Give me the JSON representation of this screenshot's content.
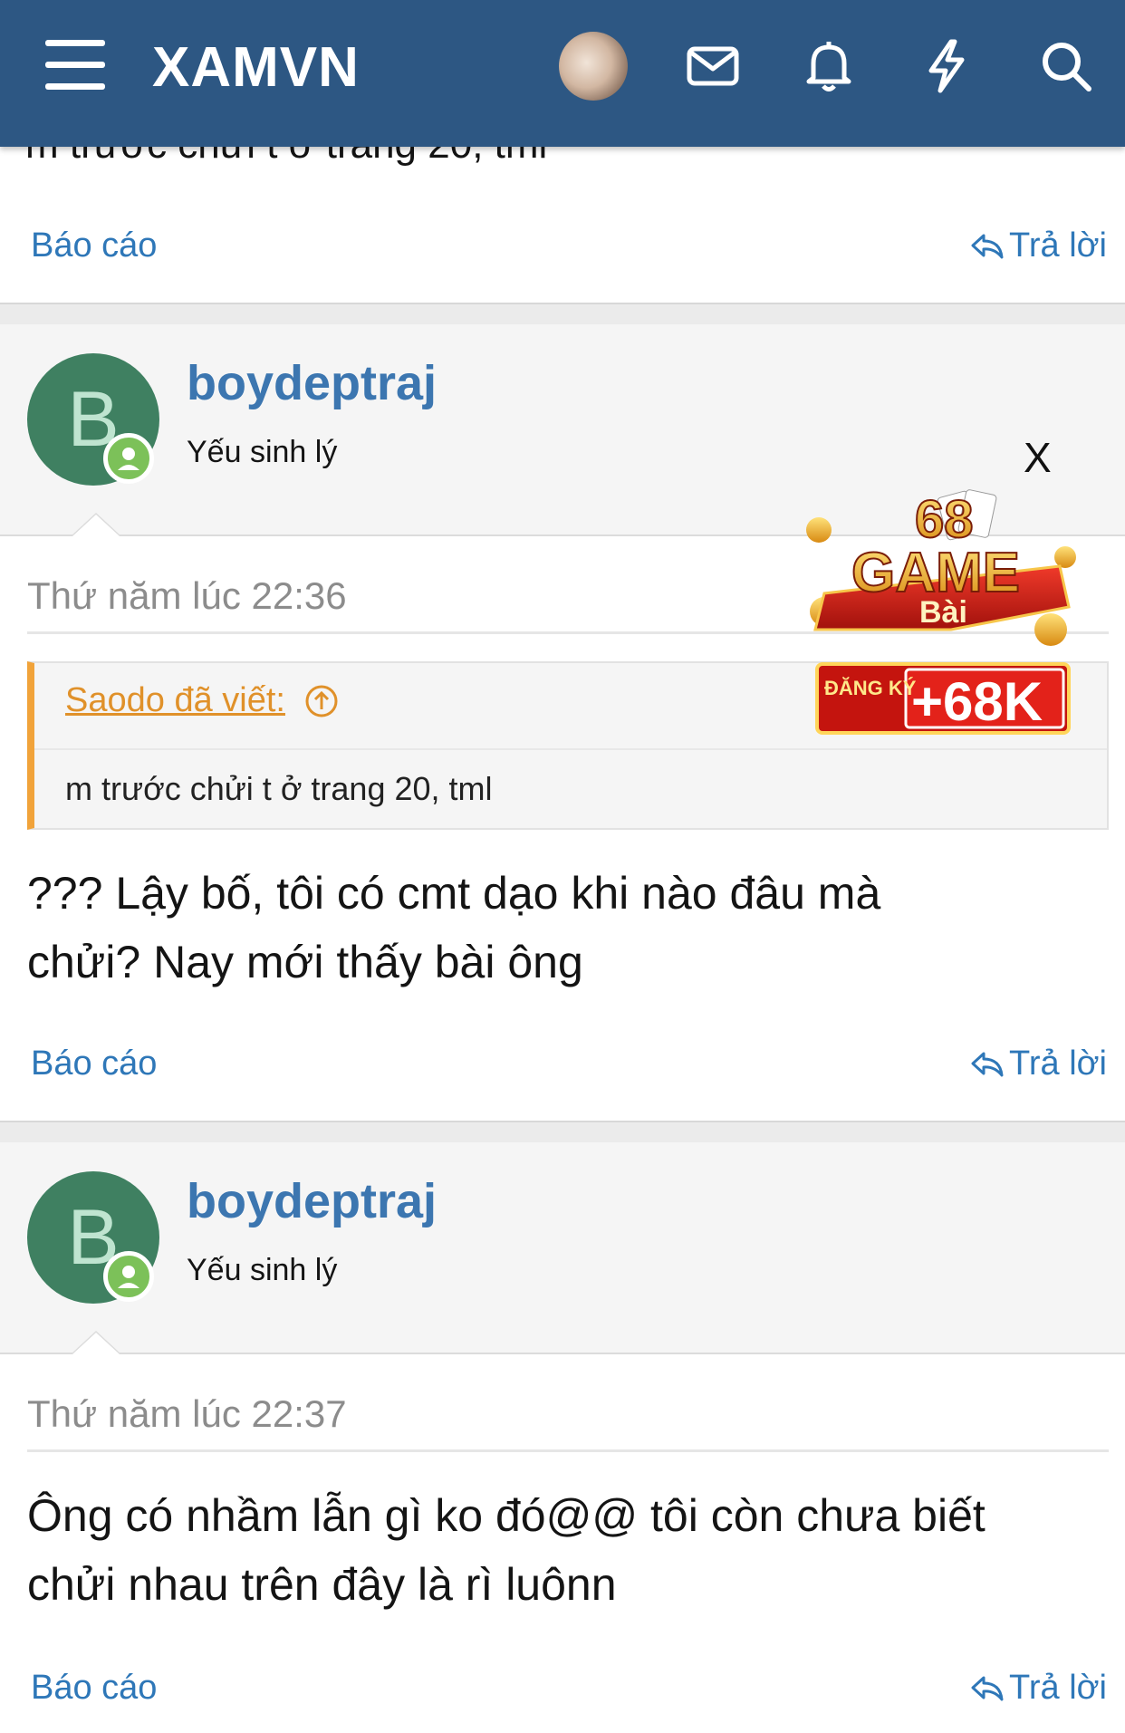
{
  "header": {
    "site_name": "XAMVN",
    "icons": [
      "menu-icon",
      "avatar",
      "mail-icon",
      "bell-icon",
      "lightning-icon",
      "search-icon"
    ],
    "bg_color": "#2d5783"
  },
  "prev_post": {
    "cut_text": "m trước chửi t ở trang 20, tml",
    "report": "Báo cáo",
    "reply": "Trả lời"
  },
  "posts": [
    {
      "avatar_letter": "B",
      "username": "boydeptraj",
      "rank": "Yếu sinh lý",
      "date": "Thứ năm lúc 22:36",
      "quote": {
        "author": "Saodo đã viết:",
        "text": "m trước chửi t ở trang 20, tml"
      },
      "text_line1": "??? Lậy bố, tôi có cmt dạo khi nào đâu mà",
      "text_line2": "chửi? Nay mới thấy bài ông",
      "report": "Báo cáo",
      "reply": "Trả lời"
    },
    {
      "avatar_letter": "B",
      "username": "boydeptraj",
      "rank": "Yếu sinh lý",
      "date": "Thứ năm lúc 22:37",
      "text_line1": "Ông có nhầm lẫn gì ko đó@@ tôi còn chưa biết",
      "text_line2": "chửi nhau trên đây là rì luônn",
      "report": "Báo cáo",
      "reply": "Trả lời"
    }
  ],
  "ad": {
    "close": "X",
    "line1": "68",
    "line2": "GAME",
    "line3": "Bài",
    "register": "ĐĂNG KÝ",
    "bonus": "+68K"
  },
  "colors": {
    "link": "#2e77b8",
    "username": "#3c76b0",
    "quote_accent": "#f1a33a",
    "avatar_bg": "#3f8061",
    "online": "#7cc159"
  }
}
